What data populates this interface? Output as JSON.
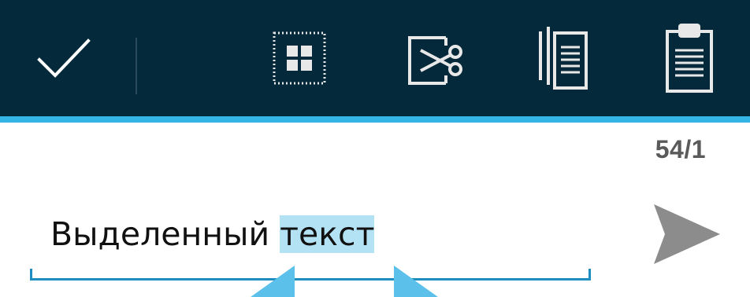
{
  "action_bar": {
    "background": "#04293a",
    "accent": "#33b5e5",
    "buttons": [
      {
        "name": "done",
        "icon": "checkmark-icon"
      },
      {
        "name": "select-all",
        "icon": "select-all-icon"
      },
      {
        "name": "cut",
        "icon": "cut-icon"
      },
      {
        "name": "copy",
        "icon": "copy-icon"
      },
      {
        "name": "paste",
        "icon": "paste-icon"
      }
    ]
  },
  "composer": {
    "counter": "54/1",
    "text_before_selection": "Выделенный ",
    "selected_text": "текст",
    "selection_color": "#b3e2f5",
    "send_icon": "send-icon"
  }
}
